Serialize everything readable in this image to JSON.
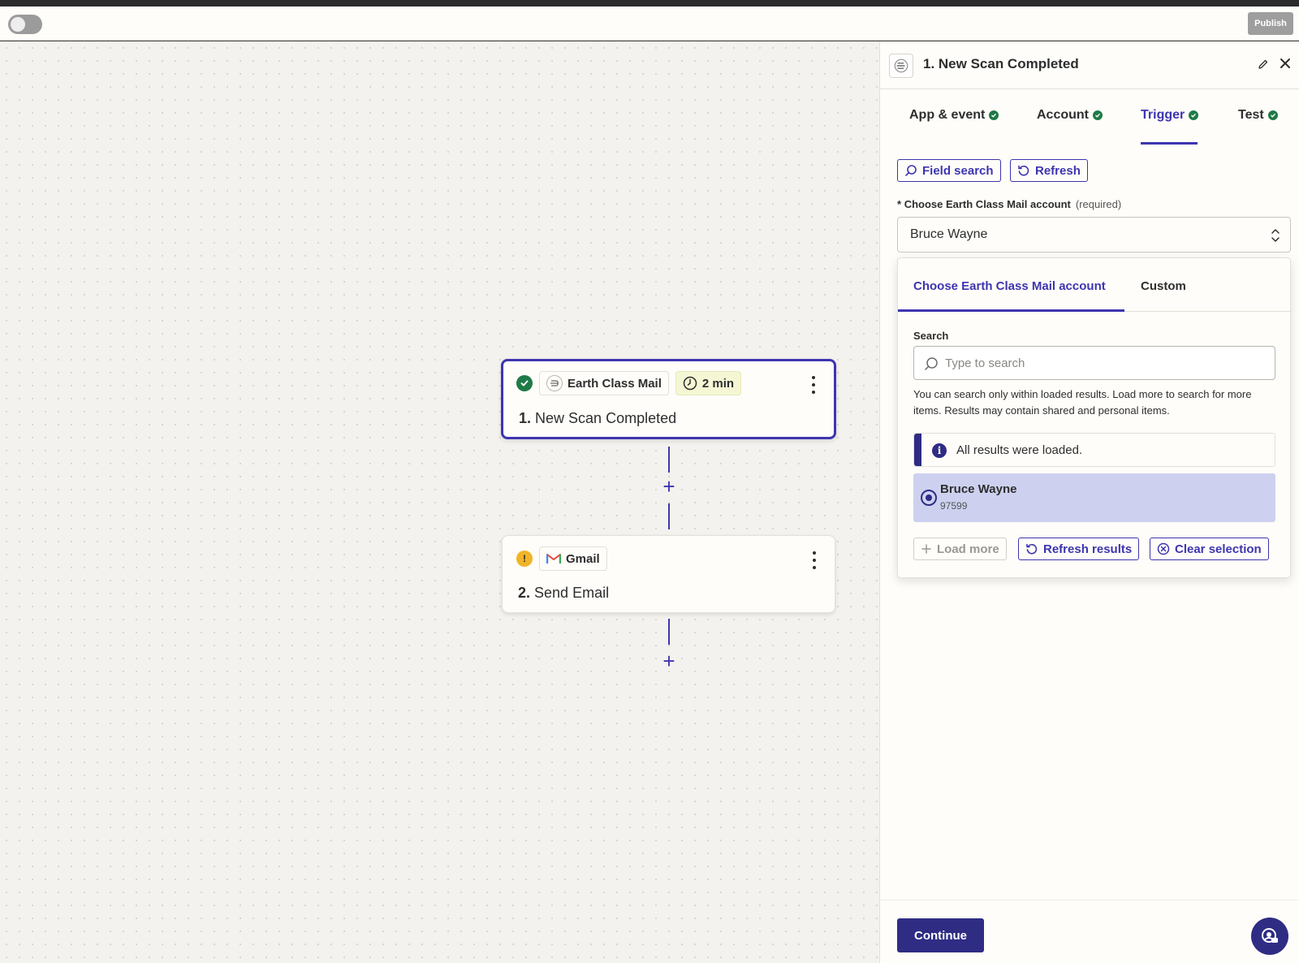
{
  "topbar": {
    "publish_label": "Publish"
  },
  "canvas": {
    "steps": [
      {
        "status": "success",
        "app_name": "Earth Class Mail",
        "badge": "2 min",
        "number": "1.",
        "title": "New Scan Completed"
      },
      {
        "status": "warning",
        "app_name": "Gmail",
        "number": "2.",
        "title": "Send Email"
      }
    ]
  },
  "panel": {
    "title": "1. New Scan Completed",
    "tabs": [
      {
        "label": "App & event",
        "complete": true
      },
      {
        "label": "Account",
        "complete": true
      },
      {
        "label": "Trigger",
        "complete": true,
        "active": true
      },
      {
        "label": "Test",
        "complete": true
      }
    ],
    "toolbar": {
      "field_search_label": "Field search",
      "refresh_label": "Refresh"
    },
    "field": {
      "required_marker": "*",
      "label": "Choose Earth Class Mail account",
      "required_text": "(required)",
      "value": "Bruce Wayne"
    },
    "dropdown": {
      "tabs": [
        "Choose Earth Class Mail account",
        "Custom"
      ],
      "search_label": "Search",
      "search_placeholder": "Type to search",
      "help_text": "You can search only within loaded results. Load more to search for more items. Results may contain shared and personal items.",
      "info_text": "All results were loaded.",
      "options": [
        {
          "name": "Bruce Wayne",
          "id": "97599",
          "selected": true
        }
      ],
      "load_more_label": "Load more",
      "refresh_results_label": "Refresh results",
      "clear_selection_label": "Clear selection"
    },
    "continue_label": "Continue"
  },
  "colors": {
    "accent": "#3d35b0",
    "accent_dark": "#2f2c84",
    "success": "#1f7a47",
    "warning": "#f0b429",
    "selected_bg": "#cdd1ef"
  }
}
